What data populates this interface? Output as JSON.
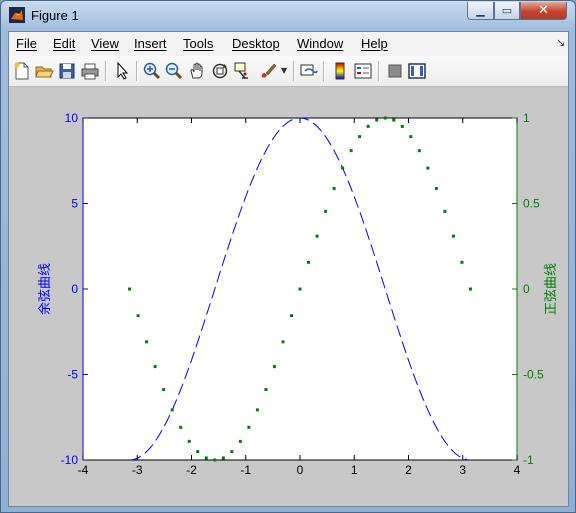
{
  "window": {
    "title": "Figure 1"
  },
  "menubar": {
    "items": [
      "File",
      "Edit",
      "View",
      "Insert",
      "Tools",
      "Desktop",
      "Window",
      "Help"
    ]
  },
  "toolbar": {
    "buttons": [
      "new-figure-icon",
      "open-file-icon",
      "save-icon",
      "print-icon",
      "arrow-pointer-icon",
      "zoom-in-icon",
      "zoom-out-icon",
      "pan-hand-icon",
      "rotate-3d-icon",
      "data-cursor-icon",
      "brush-icon",
      "link-plot-icon",
      "colorbar-icon",
      "legend-icon",
      "hide-plot-tools-icon",
      "show-plot-tools-icon"
    ]
  },
  "colors": {
    "left_axis": "#0000ff",
    "right_axis": "#008000",
    "cos_line": "#0000ff",
    "sin_marker": "#008000"
  },
  "chart_data": {
    "type": "line",
    "title": "",
    "xlabel": "",
    "ylabel_left": "余弦曲线",
    "ylabel_right": "正弦曲线",
    "xlim": [
      -4,
      4
    ],
    "ylim_left": [
      -10,
      10
    ],
    "ylim_right": [
      -1,
      1
    ],
    "xticks": [
      "-4",
      "-3",
      "-2",
      "-1",
      "0",
      "1",
      "2",
      "3",
      "4"
    ],
    "yticks_left": [
      "10",
      "5",
      "0",
      "-5",
      "-10"
    ],
    "yticks_right": [
      "1",
      "0.5",
      "0",
      "-0.5",
      "-1"
    ],
    "grid": false,
    "series": [
      {
        "axis": "left",
        "style": "dashed",
        "x_range": [
          -3.1416,
          3.1416
        ],
        "formula_points": "10*cos(x)",
        "x": [
          -3.1416,
          -2.8274,
          -2.5133,
          -2.1991,
          -1.885,
          -1.5708,
          -1.2566,
          -0.9425,
          -0.6283,
          -0.3142,
          0,
          0.3142,
          0.6283,
          0.9425,
          1.2566,
          1.5708,
          1.885,
          2.1991,
          2.5133,
          2.8274,
          3.1416
        ],
        "values": [
          -10,
          -9.51,
          -8.09,
          -5.88,
          -3.09,
          0,
          3.09,
          5.88,
          8.09,
          9.51,
          10,
          9.51,
          8.09,
          5.88,
          3.09,
          0,
          -3.09,
          -5.88,
          -8.09,
          -9.51,
          -10
        ]
      },
      {
        "axis": "right",
        "style": "dots",
        "x_start": -3.1416,
        "x_step": 0.1571,
        "count": 41,
        "values": [
          0,
          -0.156,
          -0.309,
          -0.454,
          -0.588,
          -0.707,
          -0.809,
          -0.891,
          -0.951,
          -0.988,
          -1,
          -0.988,
          -0.951,
          -0.891,
          -0.809,
          -0.707,
          -0.588,
          -0.454,
          -0.309,
          -0.156,
          0,
          0.156,
          0.309,
          0.454,
          0.588,
          0.707,
          0.809,
          0.891,
          0.951,
          0.988,
          1,
          0.988,
          0.951,
          0.891,
          0.809,
          0.707,
          0.588,
          0.454,
          0.309,
          0.156,
          0
        ]
      }
    ]
  }
}
